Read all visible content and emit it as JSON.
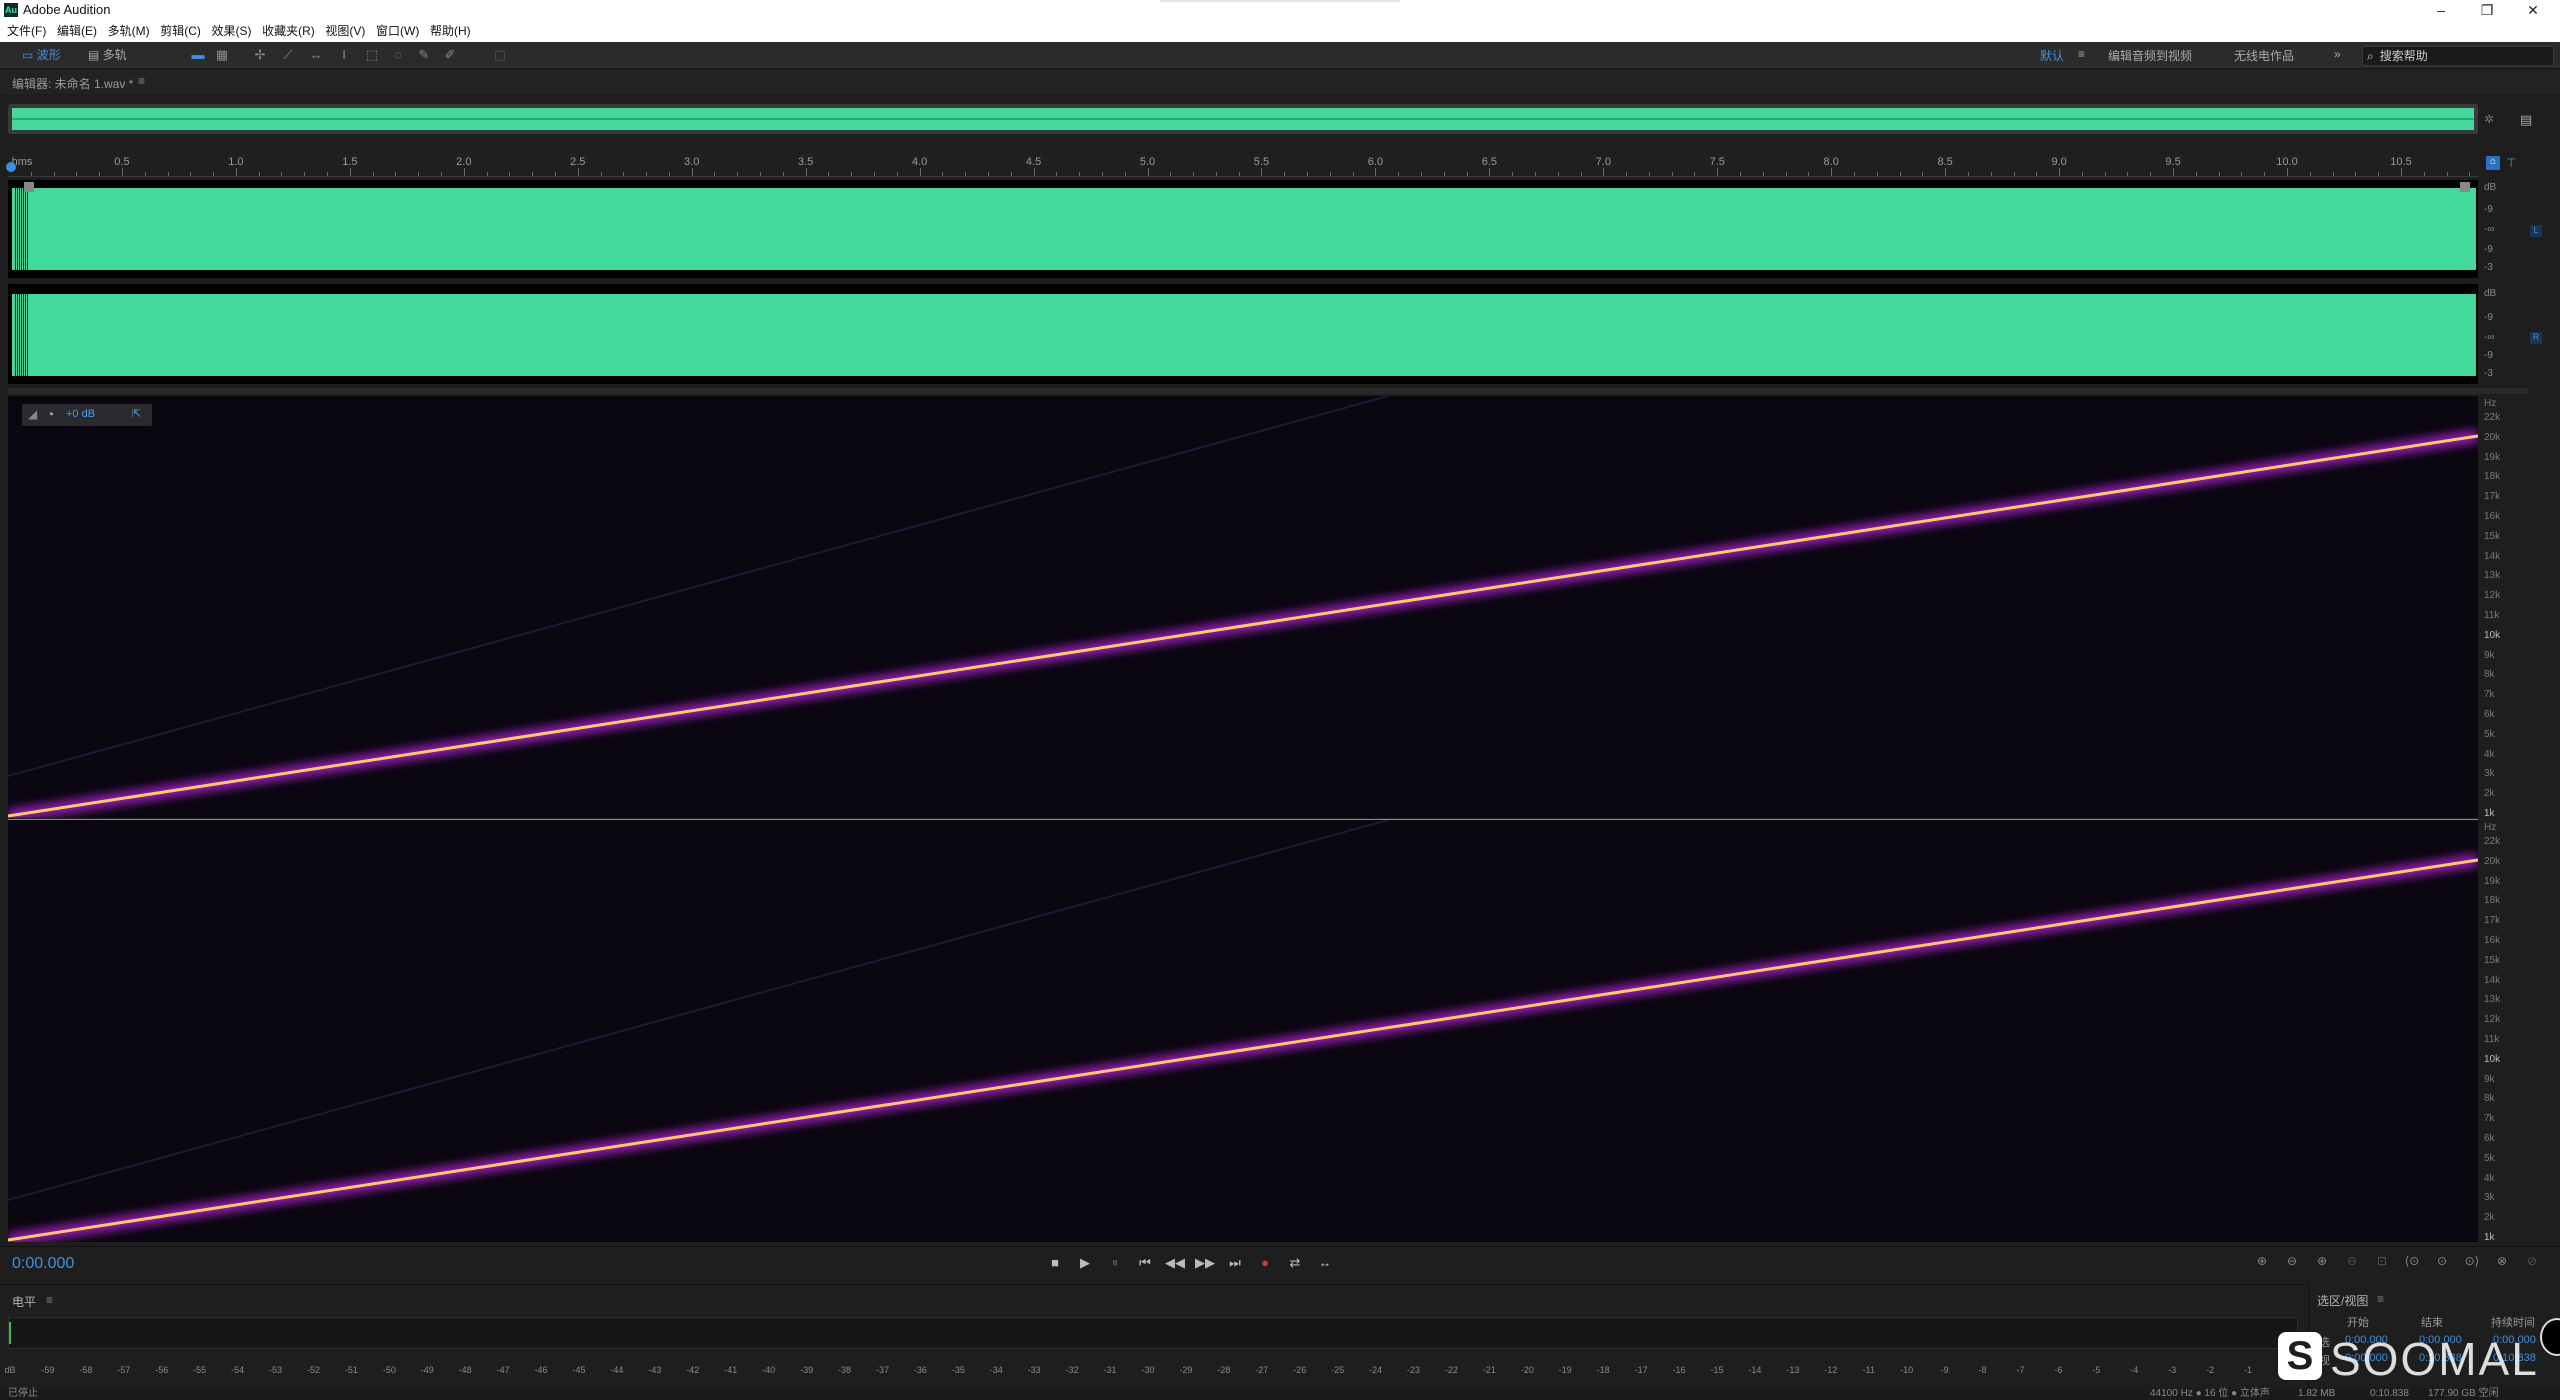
{
  "app": {
    "title": "Adobe Audition",
    "icon": "Au"
  },
  "window_controls": {
    "minimize": "–",
    "maximize": "❐",
    "close": "✕"
  },
  "menu": [
    "文件(F)",
    "编辑(E)",
    "多轨(M)",
    "剪辑(C)",
    "效果(S)",
    "收藏夹(R)",
    "视图(V)",
    "窗口(W)",
    "帮助(H)"
  ],
  "toolbar": {
    "waveform_label": "波形",
    "multitrack_label": "多轨",
    "workspaces": [
      "默认",
      "编辑音频到视频",
      "无线电作品"
    ],
    "active_workspace": "默认",
    "more": "»",
    "search_placeholder": "搜索帮助"
  },
  "editor": {
    "title": "编辑器: 未命名 1.wav *"
  },
  "timeline": {
    "unit": "hms",
    "ticks": [
      "0.5",
      "1.0",
      "1.5",
      "2.0",
      "2.5",
      "3.0",
      "3.5",
      "4.0",
      "4.5",
      "5.0",
      "5.5",
      "6.0",
      "6.5",
      "7.0",
      "7.5",
      "8.0",
      "8.5",
      "9.0",
      "9.5",
      "10.0",
      "10.5"
    ]
  },
  "waveform": {
    "db_labels": [
      "dB",
      "-9",
      "-∞",
      "-9",
      "-3"
    ],
    "channels": [
      "L",
      "R"
    ],
    "color": "#43d89c"
  },
  "spectral": {
    "hud_gain": "+0 dB",
    "hz_unit": "Hz",
    "hz_labels": [
      "22k",
      "20k",
      "19k",
      "18k",
      "17k",
      "16k",
      "15k",
      "14k",
      "13k",
      "12k",
      "11k",
      "10k",
      "9k",
      "8k",
      "7k",
      "6k",
      "5k",
      "4k",
      "3k",
      "2k",
      "1k"
    ],
    "sweep_color": "#ffd070",
    "sweep_glow": "#c020e0"
  },
  "transport": {
    "timecode": "0:00.000",
    "buttons": [
      "■",
      "▶",
      "⏸",
      "⏮",
      "◀◀",
      "▶▶",
      "⏭",
      "●",
      "⇄",
      "↔"
    ]
  },
  "level_panel": {
    "title": "电平",
    "scale": [
      "dB",
      "-59",
      "-58",
      "-57",
      "-56",
      "-55",
      "-54",
      "-53",
      "-52",
      "-51",
      "-50",
      "-49",
      "-48",
      "-47",
      "-46",
      "-45",
      "-44",
      "-43",
      "-42",
      "-41",
      "-40",
      "-39",
      "-38",
      "-37",
      "-36",
      "-35",
      "-34",
      "-33",
      "-32",
      "-31",
      "-30",
      "-29",
      "-28",
      "-27",
      "-26",
      "-25",
      "-24",
      "-23",
      "-22",
      "-21",
      "-20",
      "-19",
      "-18",
      "-17",
      "-16",
      "-15",
      "-14",
      "-13",
      "-12",
      "-11",
      "-10",
      "-9",
      "-8",
      "-7",
      "-6",
      "-5",
      "-4",
      "-3",
      "-2",
      "-1",
      "0"
    ]
  },
  "selection_panel": {
    "title": "选区/视图",
    "headers": [
      "开始",
      "结束",
      "持续时间"
    ],
    "rows": [
      {
        "label": "选",
        "start": "0:00.000",
        "end": "0:00.000",
        "duration": "0:00.000"
      },
      {
        "label": "视",
        "start": "0:00.000",
        "end": "0:10.838",
        "duration": "0:10.838"
      }
    ]
  },
  "status": {
    "state": "已停止",
    "format": "44100 Hz ● 16 位 ● 立体声",
    "size": "1.82 MB",
    "duration": "0:10.838",
    "free": "177.90 GB 空闲"
  },
  "watermark": {
    "badge": "S",
    "text": "SOOMAL"
  }
}
